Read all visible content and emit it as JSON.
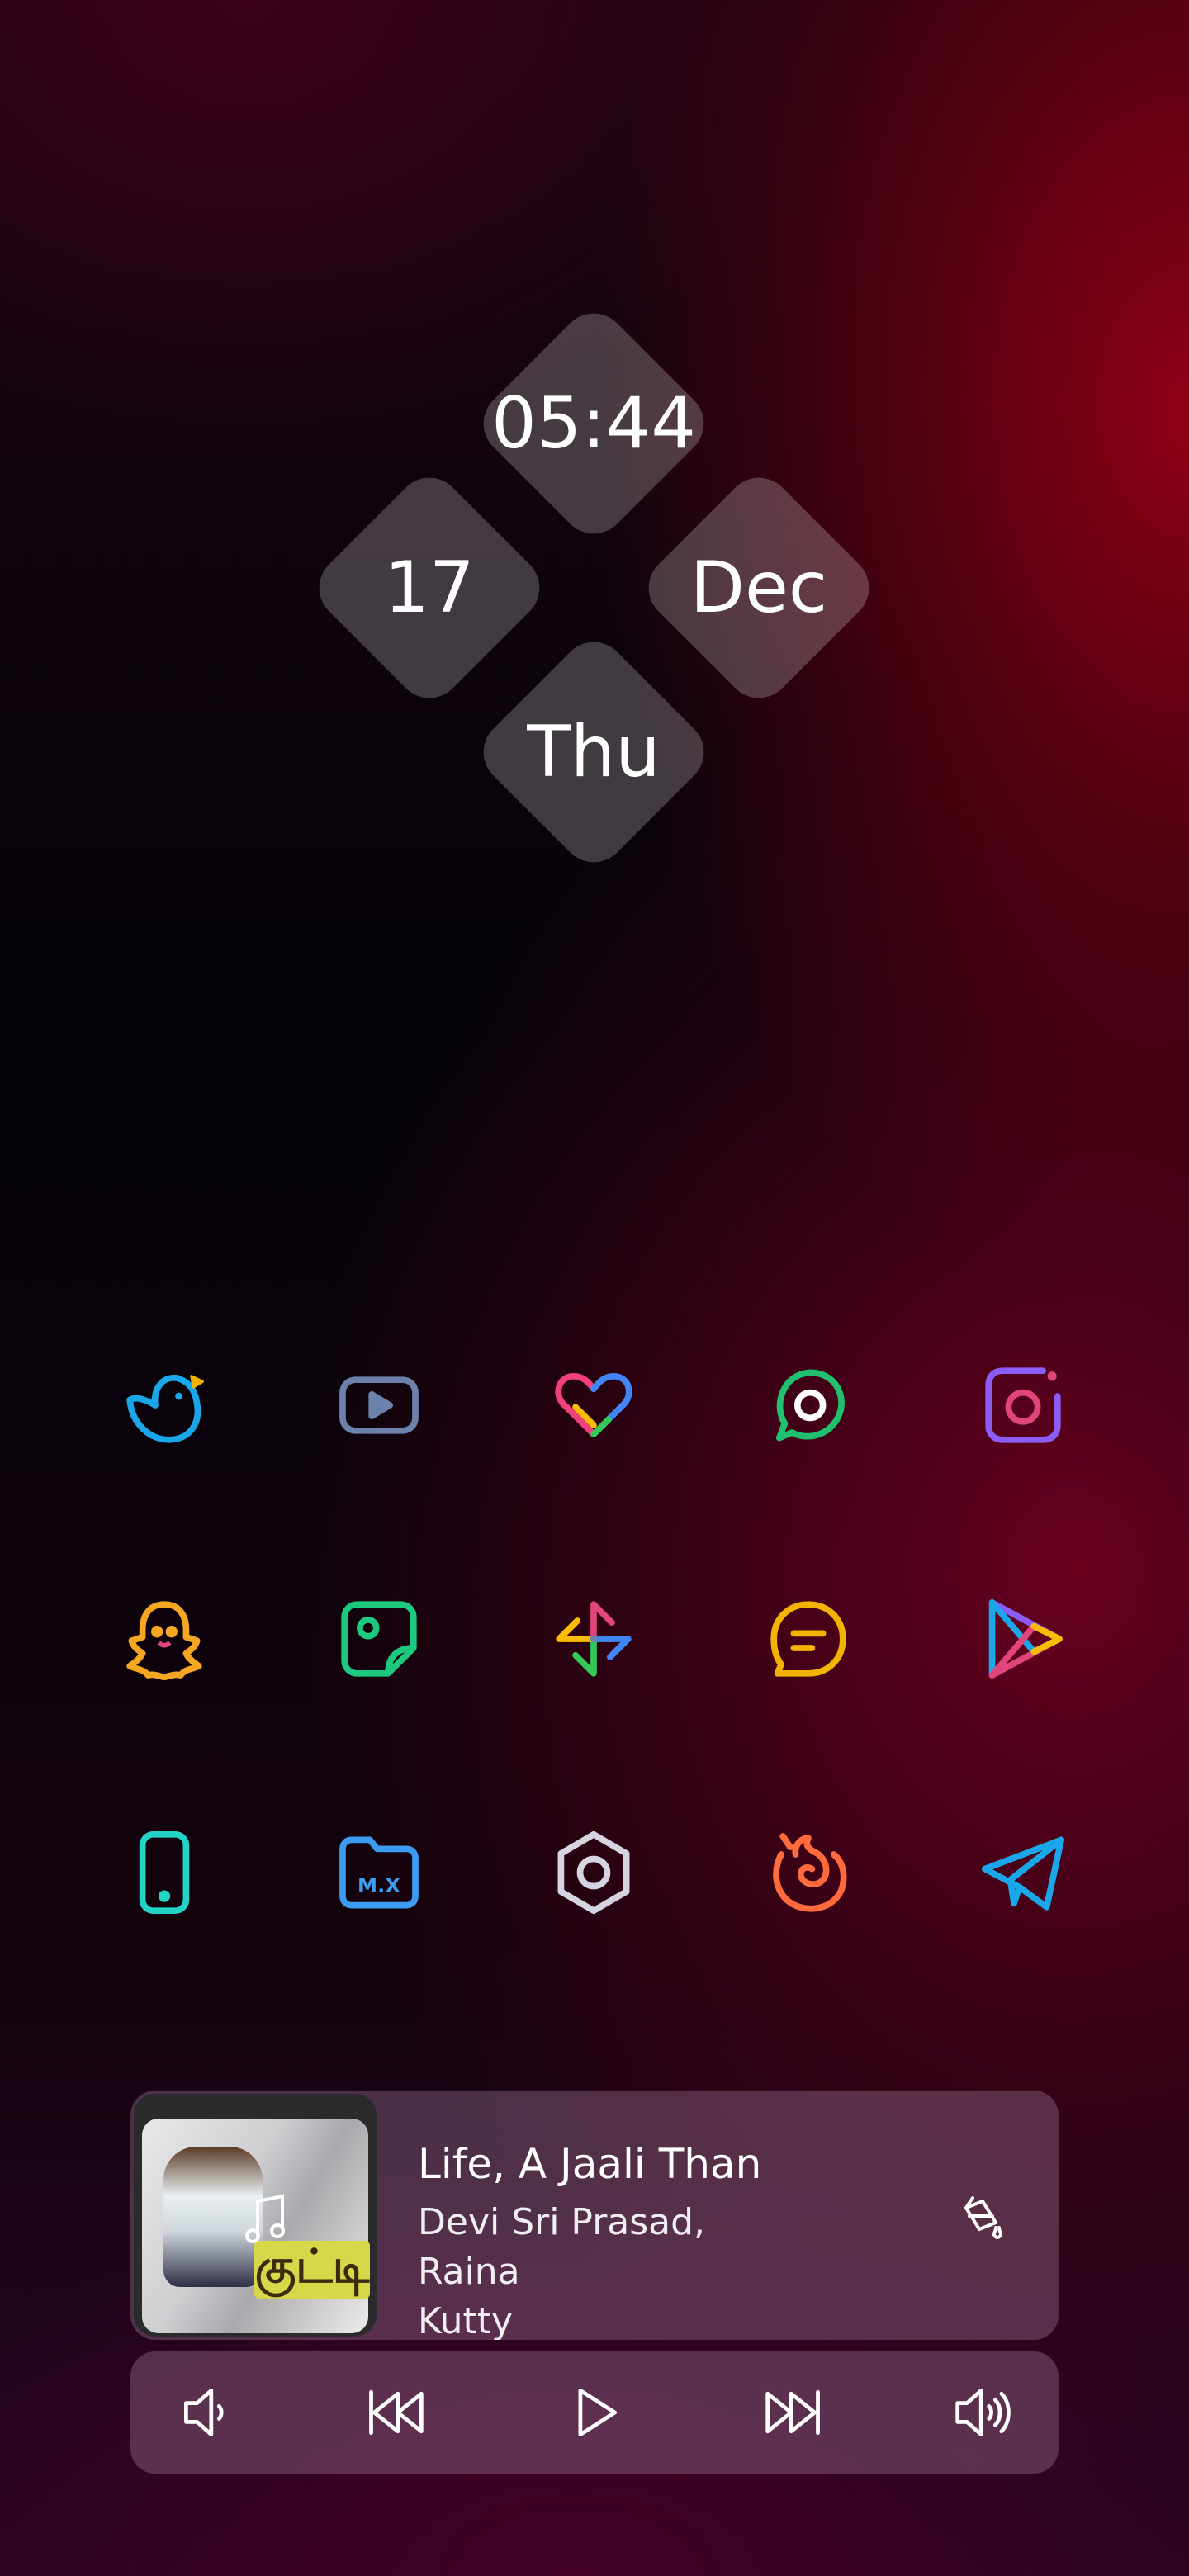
{
  "clock_widget": {
    "time": "05:44",
    "day_of_month": "17",
    "month": "Dec",
    "weekday": "Thu"
  },
  "app_grid": [
    {
      "icon": "bird-app-icon"
    },
    {
      "icon": "youtube-icon"
    },
    {
      "icon": "heart-fitness-icon"
    },
    {
      "icon": "whatsapp-icon"
    },
    {
      "icon": "instagram-icon"
    },
    {
      "icon": "snapchat-ghost-icon"
    },
    {
      "icon": "gallery-icon"
    },
    {
      "icon": "pinwheel-photos-icon"
    },
    {
      "icon": "messages-icon"
    },
    {
      "icon": "play-store-icon"
    },
    {
      "icon": "phone-device-icon"
    },
    {
      "icon": "file-manager-icon"
    },
    {
      "icon": "settings-hex-icon"
    },
    {
      "icon": "firefox-icon"
    },
    {
      "icon": "telegram-icon"
    }
  ],
  "media_player": {
    "title": "Life, A Jaali Than",
    "artist_line1": "Devi Sri Prasad, Raina",
    "artist_line2": "Kutty",
    "album_art_text": "குட்டி",
    "controls": [
      "volume-down-icon",
      "previous-icon",
      "play-icon",
      "next-icon",
      "volume-up-icon"
    ]
  },
  "colors": {
    "accent_red": "#8a0014",
    "widget_fill": "rgba(255,255,255,0.22)",
    "player_fill": "rgba(150,110,140,0.42)"
  }
}
